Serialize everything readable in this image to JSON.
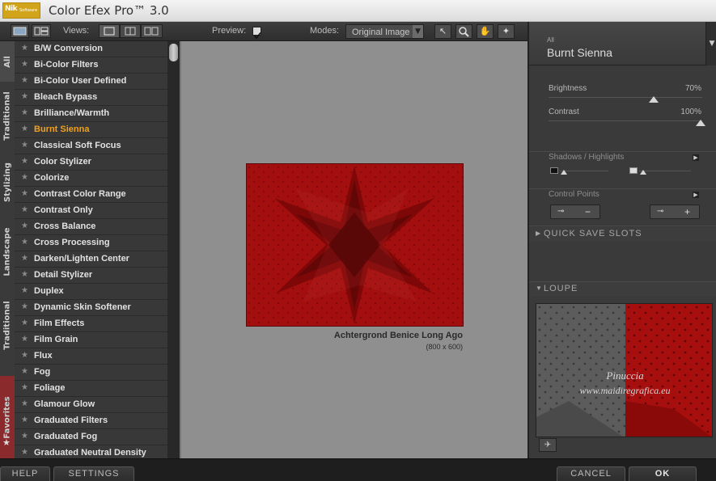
{
  "window": {
    "logo_main": "Nik",
    "logo_sub": "Software",
    "title": "Color Efex Pro™ 3.0"
  },
  "toolbar": {
    "views_label": "Views:",
    "preview_label": "Preview:",
    "preview_checked": true,
    "modes_label": "Modes:",
    "modes_value": "Original Image"
  },
  "tabs": {
    "all": "All",
    "traditional": "Traditional",
    "stylizing": "Stylizing",
    "landscape": "Landscape",
    "traditional2": "Traditional",
    "favorites": "Favorites"
  },
  "filters": [
    "B/W Conversion",
    "Bi-Color Filters",
    "Bi-Color User Defined",
    "Bleach Bypass",
    "Brilliance/Warmth",
    "Burnt Sienna",
    "Classical Soft Focus",
    "Color Stylizer",
    "Colorize",
    "Contrast Color Range",
    "Contrast Only",
    "Cross Balance",
    "Cross Processing",
    "Darken/Lighten Center",
    "Detail Stylizer",
    "Duplex",
    "Dynamic Skin Softener",
    "Film Effects",
    "Film Grain",
    "Flux",
    "Fog",
    "Foliage",
    "Glamour Glow",
    "Graduated Filters",
    "Graduated Fog",
    "Graduated Neutral Density"
  ],
  "active_filter": "Burnt Sienna",
  "preview": {
    "caption": "Achtergrond Benice Long Ago",
    "dimensions": "(800 x 600)"
  },
  "panel": {
    "category": "All",
    "filter_name": "Burnt Sienna",
    "brightness_label": "Brightness",
    "brightness_value": "70%",
    "contrast_label": "Contrast",
    "contrast_value": "100%",
    "shadows_highlights": "Shadows / Highlights",
    "control_points": "Control Points",
    "quick_save": "QUICK SAVE SLOTS",
    "loupe": "LOUPE",
    "watermark_1": "Pinuccia",
    "watermark_2": "www.maidiregrafica.eu"
  },
  "bottom": {
    "help": "HELP",
    "settings": "SETTINGS",
    "cancel": "CANCEL",
    "ok": "OK"
  }
}
